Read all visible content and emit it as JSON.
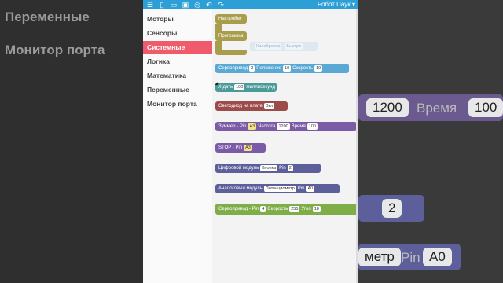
{
  "background": {
    "categories": [
      "Переменные",
      "Монитор порта"
    ],
    "values": [
      "1200",
      "Время",
      "100",
      "2",
      "метр",
      "Pin",
      "A0"
    ]
  },
  "topbar": {
    "title": "Робот Паук"
  },
  "sidebar": {
    "items": [
      {
        "label": "Моторы"
      },
      {
        "label": "Сенсоры"
      },
      {
        "label": "Системные"
      },
      {
        "label": "Логика"
      },
      {
        "label": "Математика"
      },
      {
        "label": "Переменные"
      },
      {
        "label": "Монитор порта"
      }
    ]
  },
  "blocks": {
    "settings": "Настройки",
    "program": "Программа",
    "calibration": "Калибровка",
    "speed": "Быстро",
    "servo1": {
      "label": "Сервопривод",
      "pin": "2",
      "position_label": "Положение",
      "position": "10",
      "speed_label": "Скорость",
      "speed": "10"
    },
    "wait": {
      "label": "Ждать",
      "value": "100",
      "unit": "миллисекунд"
    },
    "led": {
      "label": "Светодиод на плате",
      "value": "Вкл"
    },
    "buzzer": {
      "label": "Зуммер - Pin",
      "pin": "A3",
      "freq_label": "Частота",
      "freq": "1200",
      "time_label": "Время",
      "time": "100"
    },
    "stop": {
      "label": "STOP - Pin",
      "pin": "A3"
    },
    "digital": {
      "label": "Цифровой модуль",
      "module": "Кнопка",
      "pin_label": "Pin",
      "pin": "2"
    },
    "analog": {
      "label": "Аналоговый модуль",
      "module": "Потенциометр",
      "pin_label": "Pin",
      "pin": "A0"
    },
    "servo2": {
      "label": "Сервопривод - Pin",
      "pin": "4",
      "speed_label": "Скорость",
      "speed": "255",
      "angle_label": "Угол",
      "angle": "18"
    }
  },
  "colors": {
    "topbar": "#2c9fd6",
    "active": "#ef5b6b",
    "olive": "#a89d4a",
    "blue": "#5aa9d4",
    "teal": "#4b9a9a",
    "brown": "#9c4a4a",
    "purple": "#7b5aa6",
    "slate": "#5c5f9a",
    "green": "#7fae48"
  }
}
